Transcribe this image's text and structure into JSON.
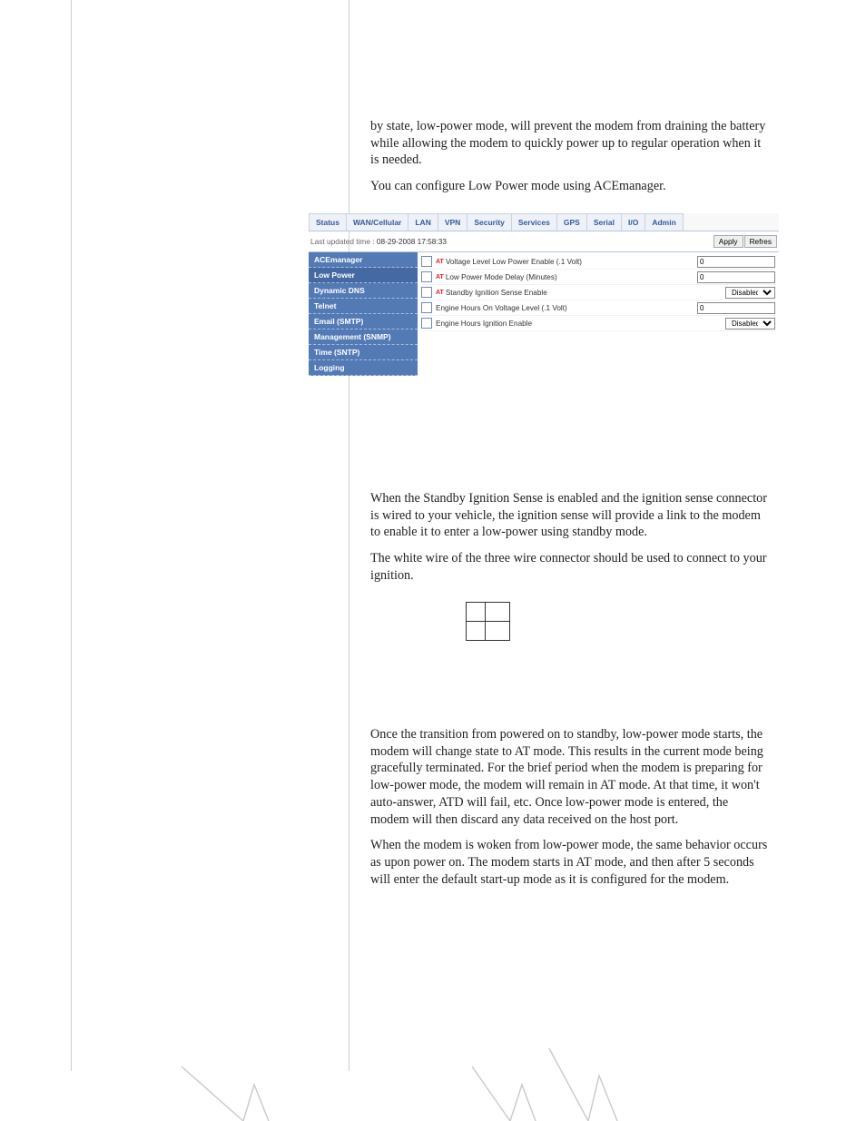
{
  "paragraphs": {
    "p1": "by state, low-power mode, will prevent the modem from draining the battery while allowing the modem to quickly power up to regular operation when it is needed.",
    "p2": "You can configure Low Power mode using ACEmanager.",
    "p3": "When the Standby Ignition Sense is enabled and the ignition sense connector is wired to your vehicle, the ignition sense will provide a link to the modem to enable it to enter a low-power using standby mode.",
    "p4": "The white wire of the three wire connector should be used to connect to your ignition.",
    "p5": "Once the transition from powered on to standby, low-power mode starts, the modem will change state to AT mode. This results in the current mode being gracefully terminated. For the brief period when the modem is preparing for low-power mode, the modem will remain in AT mode. At that time, it won't auto-answer, ATD will fail, etc. Once low-power mode is entered, the modem will then discard any data received on the host port.",
    "p6": "When the modem is woken from low-power mode, the same behavior occurs as upon power on. The modem starts in AT mode, and then after 5 seconds will enter the default start-up mode as it is configured for the modem."
  },
  "ace": {
    "tabs": [
      "Status",
      "WAN/Cellular",
      "LAN",
      "VPN",
      "Security",
      "Services",
      "GPS",
      "Serial",
      "I/O",
      "Admin"
    ],
    "updated_label": "Last updated time :",
    "updated_time": "08-29-2008 17:58:33",
    "apply": "Apply",
    "refresh": "Refres",
    "sidebar": [
      "ACEmanager",
      "Low Power",
      "Dynamic DNS",
      "Telnet",
      "Email (SMTP)",
      "Management (SNMP)",
      "Time (SNTP)",
      "Logging"
    ],
    "rows": [
      {
        "at": true,
        "label": "Voltage Level Low Power Enable (.1 Volt)",
        "type": "text",
        "value": "0"
      },
      {
        "at": true,
        "label": "Low Power Mode Delay (Minutes)",
        "type": "text",
        "value": "0"
      },
      {
        "at": true,
        "label": "Standby Ignition Sense Enable",
        "type": "select",
        "value": "Disabled"
      },
      {
        "at": false,
        "label": "Engine Hours On Voltage Level (.1 Volt)",
        "type": "text",
        "value": "0"
      },
      {
        "at": false,
        "label": "Engine Hours Ignition Enable",
        "type": "select",
        "value": "Disabled"
      }
    ]
  }
}
